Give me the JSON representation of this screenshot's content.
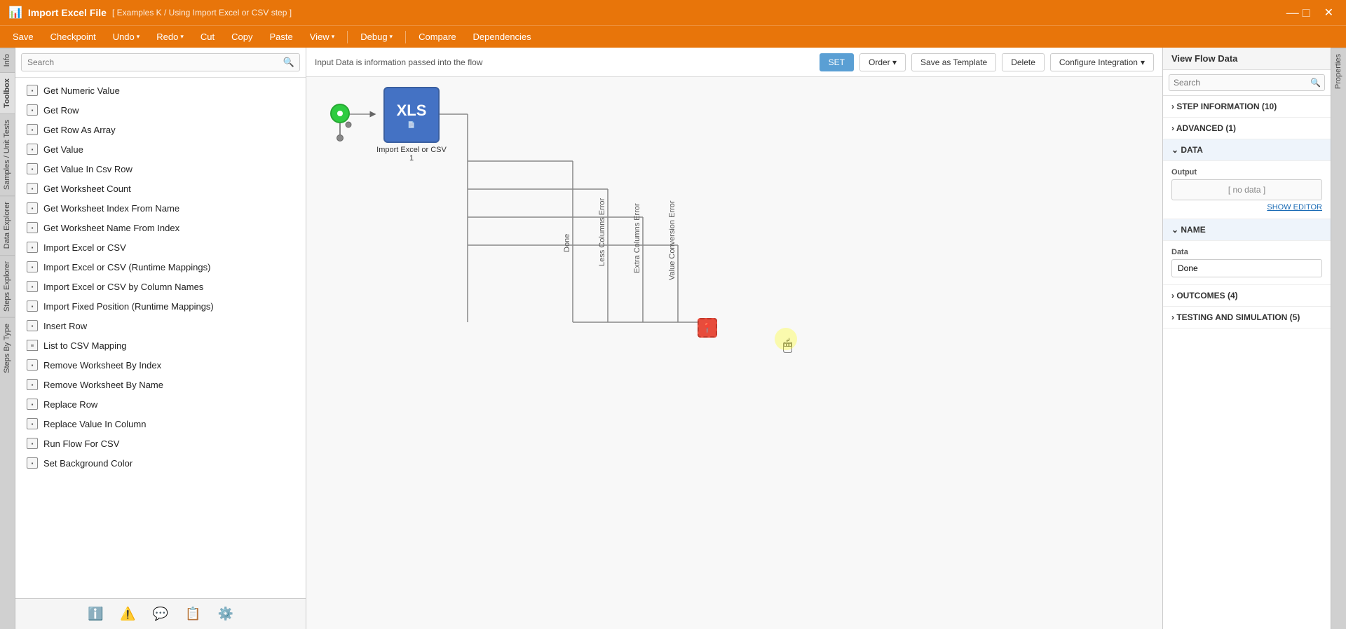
{
  "titleBar": {
    "appTitle": "Import Excel File",
    "subtitle": "[ Examples K / Using Import Excel or CSV step ]",
    "closeBtn": "✕"
  },
  "menuBar": {
    "items": [
      {
        "label": "Save",
        "hasDropdown": false
      },
      {
        "label": "Checkpoint",
        "hasDropdown": false
      },
      {
        "label": "Undo",
        "hasDropdown": true
      },
      {
        "label": "Redo",
        "hasDropdown": true
      },
      {
        "label": "Cut",
        "hasDropdown": false
      },
      {
        "label": "Copy",
        "hasDropdown": false
      },
      {
        "label": "Paste",
        "hasDropdown": false
      },
      {
        "label": "View",
        "hasDropdown": true
      },
      {
        "label": "Debug",
        "hasDropdown": true
      },
      {
        "label": "Compare",
        "hasDropdown": false
      },
      {
        "label": "Dependencies",
        "hasDropdown": false
      }
    ]
  },
  "leftTabs": [
    "Info",
    "Toolbox",
    "Samples / Unit Tests",
    "Data Explorer",
    "Steps Explorer",
    "Steps By Type"
  ],
  "searchPlaceholder": "Search",
  "toolboxItems": [
    {
      "label": "Get Numeric Value",
      "type": "box"
    },
    {
      "label": "Get Row",
      "type": "box"
    },
    {
      "label": "Get Row As Array",
      "type": "box"
    },
    {
      "label": "Get Value",
      "type": "box"
    },
    {
      "label": "Get Value In Csv Row",
      "type": "box"
    },
    {
      "label": "Get Worksheet Count",
      "type": "box"
    },
    {
      "label": "Get Worksheet Index From Name",
      "type": "box"
    },
    {
      "label": "Get Worksheet Name From Index",
      "type": "box"
    },
    {
      "label": "Import Excel or CSV",
      "type": "box"
    },
    {
      "label": "Import Excel or CSV (Runtime Mappings)",
      "type": "box"
    },
    {
      "label": "Import Excel or CSV by Column Names",
      "type": "box"
    },
    {
      "label": "Import Fixed Position (Runtime Mappings)",
      "type": "box"
    },
    {
      "label": "Insert Row",
      "type": "box"
    },
    {
      "label": "List to CSV Mapping",
      "type": "list"
    },
    {
      "label": "Remove Worksheet By Index",
      "type": "box"
    },
    {
      "label": "Remove Worksheet By Name",
      "type": "box"
    },
    {
      "label": "Replace Row",
      "type": "box"
    },
    {
      "label": "Replace Value In Column",
      "type": "box"
    },
    {
      "label": "Run Flow For CSV",
      "type": "box"
    },
    {
      "label": "Set Background Color",
      "type": "box"
    }
  ],
  "bottomToolbar": {
    "buttons": [
      "ℹ",
      "⚠",
      "💬",
      "📄",
      "⚙"
    ]
  },
  "canvasToolbar": {
    "infoText": "Input Data is information passed into the flow",
    "setBtnLabel": "SET",
    "orderLabel": "Order",
    "saveAsTemplate": "Save as Template",
    "deleteLabel": "Delete",
    "configureLabel": "Configure Integration"
  },
  "flowDiagram": {
    "nodeName": "Import Excel or CSV 1",
    "branchLabels": [
      "Done",
      "Less Columns Error",
      "Extra Columns Error",
      "Value Conversion Error"
    ]
  },
  "rightPanel": {
    "viewFlowData": "View Flow Data",
    "searchPlaceholder": "Search",
    "sections": [
      {
        "label": "STEP INFORMATION",
        "count": 10,
        "expanded": false
      },
      {
        "label": "ADVANCED",
        "count": 1,
        "expanded": false
      },
      {
        "label": "DATA",
        "count": null,
        "expanded": true
      },
      {
        "label": "NAME",
        "count": null,
        "expanded": true
      },
      {
        "label": "OUTCOMES",
        "count": 4,
        "expanded": false
      },
      {
        "label": "TESTING AND SIMULATION",
        "count": 5,
        "expanded": false
      }
    ],
    "dataOutput": "[ no data ]",
    "showEditor": "SHOW EDITOR",
    "nameLabel": "Data",
    "nameValue": "Done"
  }
}
